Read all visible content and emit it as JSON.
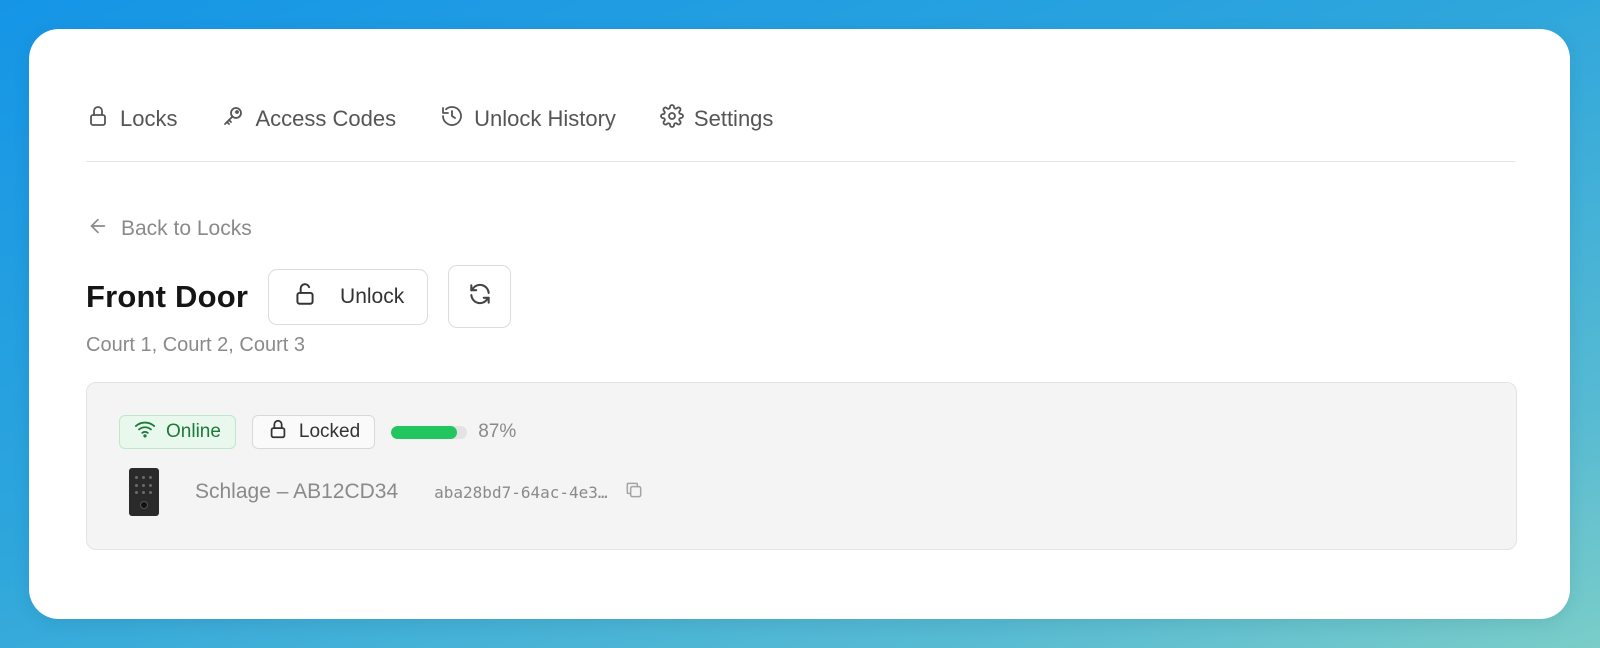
{
  "nav": {
    "tabs": [
      {
        "label": "Locks",
        "icon": "lock-icon"
      },
      {
        "label": "Access Codes",
        "icon": "key-icon"
      },
      {
        "label": "Unlock History",
        "icon": "history-icon"
      },
      {
        "label": "Settings",
        "icon": "gear-icon"
      }
    ]
  },
  "back": {
    "label": "Back to Locks",
    "icon": "arrow-left-icon"
  },
  "lock": {
    "title": "Front Door",
    "unlock_label": "Unlock",
    "subtitle": "Court 1, Court 2, Court 3"
  },
  "status": {
    "online_label": "Online",
    "locked_label": "Locked",
    "battery_percent": 87,
    "battery_text": "87%",
    "battery_color": "#22c55e"
  },
  "device": {
    "name": "Schlage – AB12CD34",
    "id": "aba28bd7-64ac-4e3…"
  },
  "colors": {
    "accent_green": "#22c55e",
    "online_text": "#1c7a3a"
  }
}
